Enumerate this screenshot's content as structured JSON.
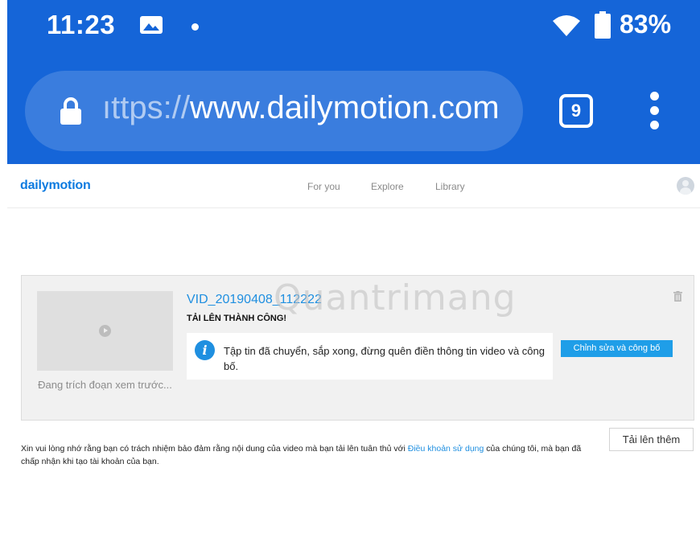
{
  "status_bar": {
    "time": "11:23",
    "battery": "83%"
  },
  "browser": {
    "url_scheme": "ıttps://",
    "url_host": "www.dailymotion.com",
    "tab_count": "9"
  },
  "site": {
    "logo": "dailymotion",
    "nav": [
      "For you",
      "Explore",
      "Library"
    ]
  },
  "upload": {
    "thumb_caption": "Đang trích đoạn xem trước...",
    "video_title": "VID_20190408_112222",
    "status": "TẢI LÊN THÀNH CÔNG!",
    "info_message": "Tập tin đã chuyển, sắp xong, đừng quên điền thông tin video và công bố.",
    "edit_button": "Chỉnh sửa và công bố",
    "upload_more": "Tải lên thêm"
  },
  "disclaimer": {
    "text_before": "Xin vui lòng nhớ rằng bạn có trách nhiệm bảo đảm rằng nội dung của video mà bạn tải lên tuân thủ với ",
    "link": "Điều khoản sử dụng",
    "text_after": " của chúng tôi, mà bạn đã chấp nhận khi tạo tài khoản của bạn."
  },
  "watermark": "Quantrimang",
  "colors": {
    "chrome_blue": "#1565d8",
    "brand_blue": "#0d7be0",
    "link_blue": "#1f8fe0",
    "button_blue": "#1f9ee8"
  }
}
